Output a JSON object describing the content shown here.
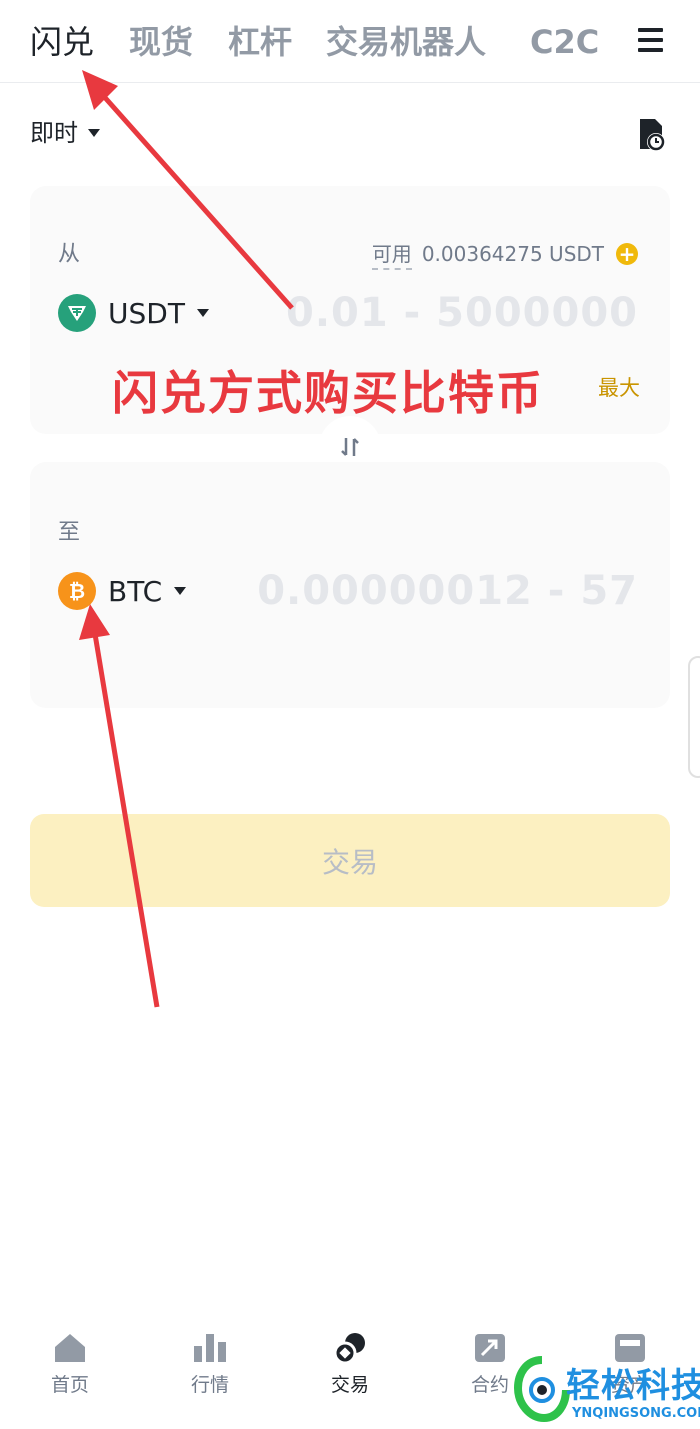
{
  "top_tabs": [
    {
      "label": "闪兑",
      "active": true
    },
    {
      "label": "现货",
      "active": false
    },
    {
      "label": "杠杆",
      "active": false
    },
    {
      "label": "交易机器人",
      "active": false
    },
    {
      "label": "C2C",
      "active": false
    }
  ],
  "mode": {
    "label": "即时"
  },
  "from_card": {
    "label": "从",
    "available_label": "可用",
    "available_value": "0.00364275 USDT",
    "coin": "USDT",
    "amount_placeholder": "0.01 - 5000000",
    "max_label": "最大"
  },
  "to_card": {
    "label": "至",
    "coin": "BTC",
    "amount_placeholder": "0.00000012 - 57"
  },
  "annotation": {
    "text": "闪兑方式购买比特币",
    "color": "#e8393f"
  },
  "trade_button": {
    "label": "交易"
  },
  "bottom_nav": [
    {
      "label": "首页",
      "icon": "home-icon",
      "active": false
    },
    {
      "label": "行情",
      "icon": "markets-icon",
      "active": false
    },
    {
      "label": "交易",
      "icon": "trade-icon",
      "active": true
    },
    {
      "label": "合约",
      "icon": "futures-icon",
      "active": false
    },
    {
      "label": "资产",
      "icon": "wallet-icon",
      "active": false
    }
  ],
  "watermark": {
    "text": "轻松科技",
    "subtext": "YNQINGSONG.COM"
  },
  "colors": {
    "brand_yellow": "#f0b90b",
    "text_primary": "#1e2329",
    "text_secondary": "#707a8a",
    "annotation_red": "#e8393f"
  }
}
